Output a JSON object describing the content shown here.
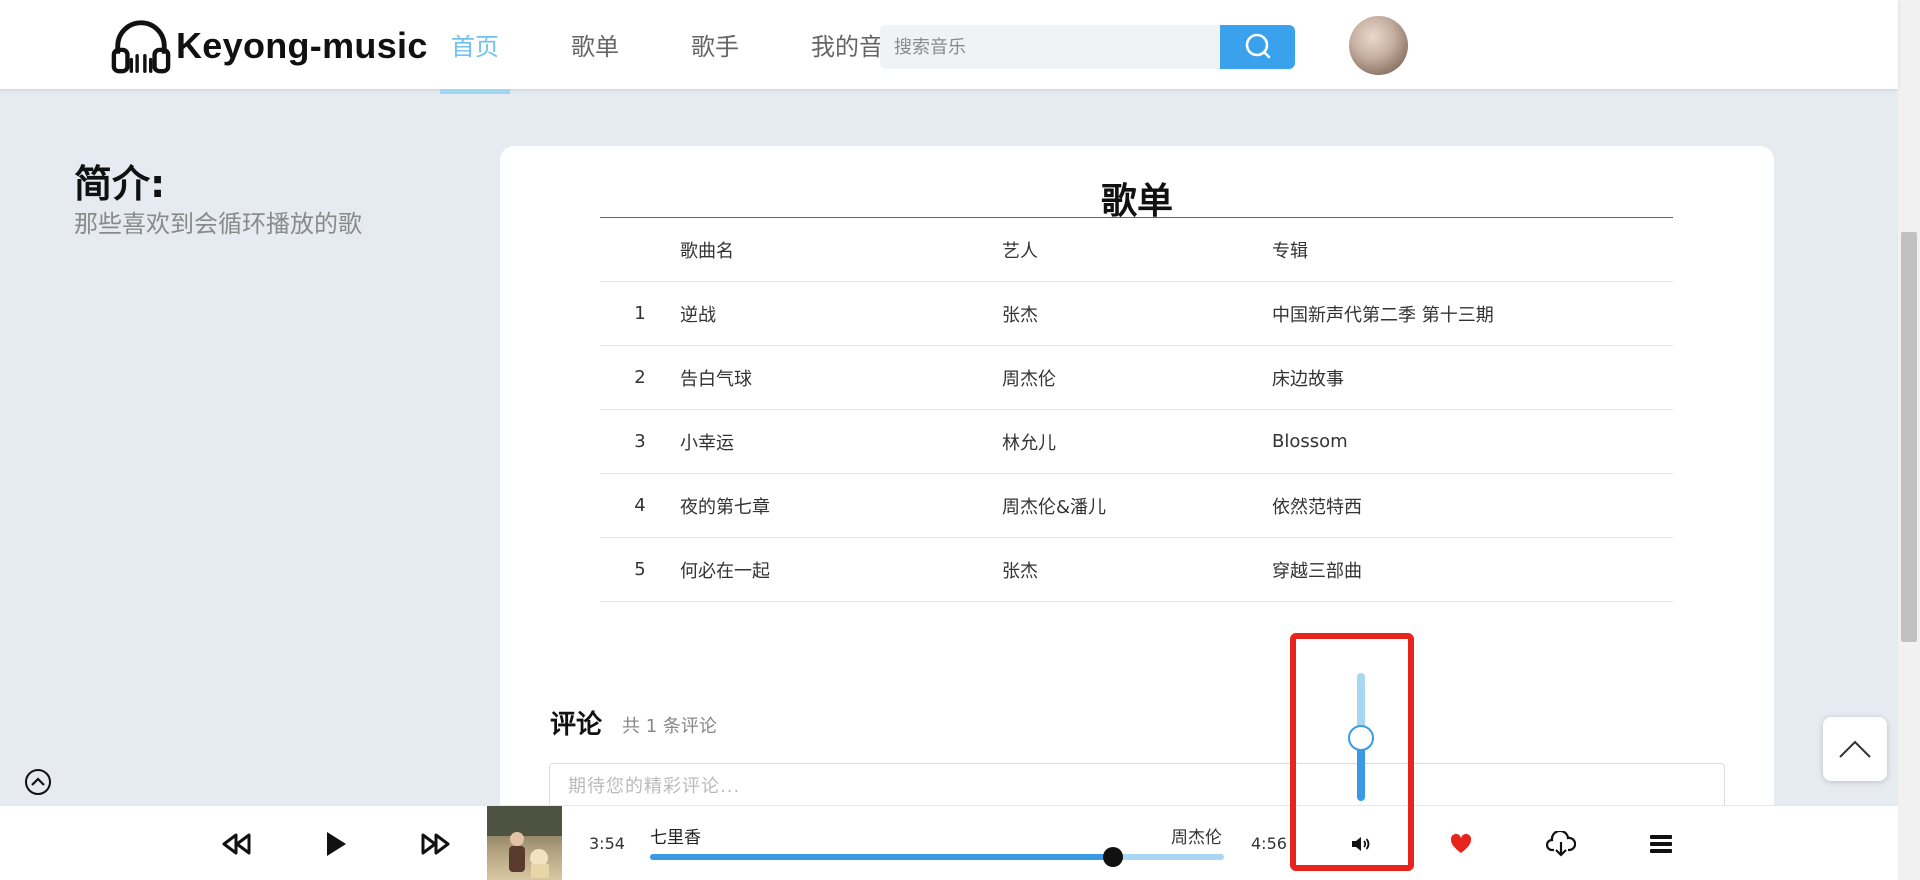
{
  "header": {
    "logo_text": "Keyong-music",
    "nav": [
      {
        "label": "首页",
        "active": true
      },
      {
        "label": "歌单",
        "active": false
      },
      {
        "label": "歌手",
        "active": false
      },
      {
        "label": "我的音乐",
        "active": false
      }
    ],
    "search": {
      "placeholder": "搜索音乐",
      "value": ""
    }
  },
  "intro": {
    "title": "简介:",
    "description": "那些喜欢到会循环播放的歌"
  },
  "playlist": {
    "title": "歌单",
    "columns": [
      "",
      "歌曲名",
      "艺人",
      "专辑"
    ],
    "rows": [
      {
        "index": "1",
        "name": "逆战",
        "artist": "张杰",
        "album": "中国新声代第二季 第十三期"
      },
      {
        "index": "2",
        "name": "告白气球",
        "artist": "周杰伦",
        "album": "床边故事"
      },
      {
        "index": "3",
        "name": "小幸运",
        "artist": "林允儿",
        "album": "Blossom"
      },
      {
        "index": "4",
        "name": "夜的第七章",
        "artist": "周杰伦&潘儿",
        "album": "依然范特西"
      },
      {
        "index": "5",
        "name": "何必在一起",
        "artist": "张杰",
        "album": "穿越三部曲"
      }
    ]
  },
  "comments": {
    "title": "评论",
    "count_text": "共 1 条评论",
    "placeholder": "期待您的精彩评论..."
  },
  "player": {
    "song_title": "七里香",
    "artist": "周杰伦",
    "current_time": "3:54",
    "total_time": "4:56",
    "progress_fraction": 0.79,
    "volume_fraction": 0.5
  },
  "icons": {
    "prev": "rewind-icon",
    "play": "play-icon",
    "next": "fast-forward-icon",
    "volume": "volume-icon",
    "like": "heart-icon",
    "download": "cloud-download-icon",
    "playlist": "menu-icon",
    "back_to_top": "chevron-up-icon",
    "collapse": "chevron-up-circle-icon",
    "search": "search-icon"
  },
  "colors": {
    "accent": "#3aa1ec",
    "nav_active": "#72c2ee",
    "like": "#e8251c",
    "highlight_box": "#e8251c",
    "background": "#e6ebf1"
  }
}
